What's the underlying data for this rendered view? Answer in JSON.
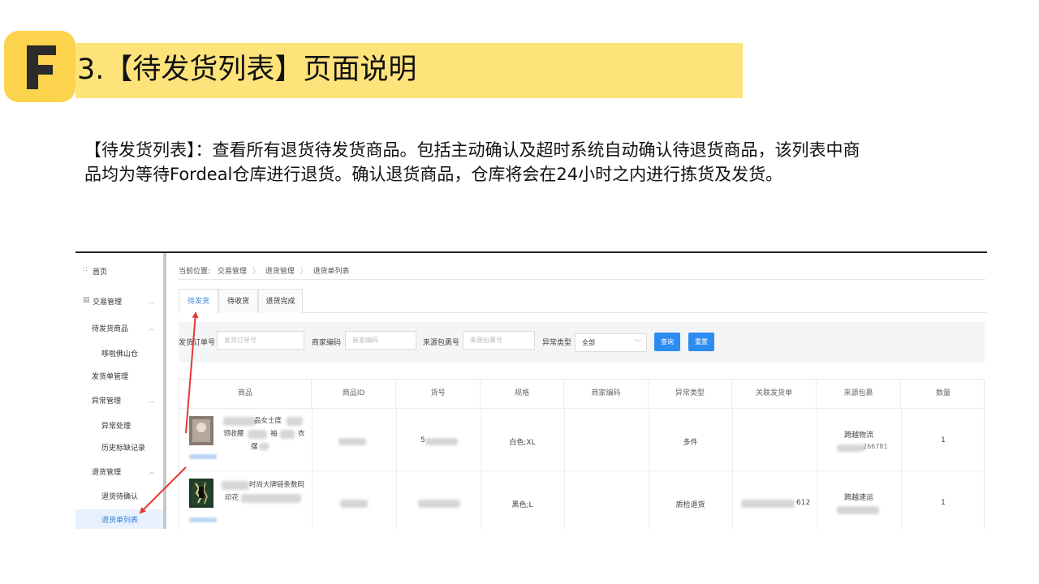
{
  "header": {
    "logo_letter": "F",
    "title": "3.【待发货列表】页面说明",
    "accent_color": "#fde37a",
    "logo_color": "#fcd34d"
  },
  "description": {
    "line1": "【待发货列表】：查看所有退货待发货商品。包括主动确认及超时系统自动确认待退货商品，该列表中商",
    "line2": "品均为等待Fordeal仓库进行退货。确认退货商品，仓库将会在24小时之内进行拣货及发货。"
  },
  "sidebar": {
    "home": "首页",
    "trade_mgmt": "交易管理",
    "pending_goods": "待发货商品",
    "warehouse": "哆啦佛山仓",
    "shipment_mgmt": "发货单管理",
    "exception_mgmt": "异常管理",
    "exception_handle": "异常处理",
    "history_log": "历史标缺记录",
    "return_mgmt": "退货管理",
    "return_confirm": "退货待确认",
    "return_list": "退货单列表",
    "home_icon": "grid-icon",
    "trade_icon": "document-icon"
  },
  "breadcrumb": {
    "prefix": "当前位置:",
    "items": [
      "交易管理",
      "退货管理",
      "退货单列表"
    ]
  },
  "tabs": [
    "待发货",
    "待收货",
    "退货完成"
  ],
  "filters": {
    "order_label": "发货订单号",
    "order_placeholder": "发货订单号",
    "merchant_label": "商家编码",
    "merchant_placeholder": "商家编码",
    "package_label": "来源包裹号",
    "package_placeholder": "来源包裹号",
    "type_label": "异常类型",
    "type_value": "全部",
    "query_button": "查询",
    "reset_button": "重置"
  },
  "table": {
    "headers": [
      "商品",
      "商品ID",
      "货号",
      "规格",
      "商家编码",
      "异常类型",
      "关联发货单",
      "来源包裹",
      "数量"
    ],
    "rows": [
      {
        "product_l1": "品女士度",
        "product_l2_a": "领收腰",
        "product_l2_b": "袖",
        "product_l2_c": "衣",
        "product_l3": "摆",
        "sku_prefix": "5",
        "spec": "白色;XL",
        "type": "多件",
        "linked": "",
        "source": "跨越物流",
        "source_no": "266781",
        "qty": "1"
      },
      {
        "product_l1": "时尚大牌链条数码",
        "product_l2": "印花",
        "sku_prefix": "",
        "spec": "黑色;L",
        "type": "质检退货",
        "linked": "612",
        "source": "跨越速运",
        "source_no": "",
        "qty": "1"
      }
    ]
  },
  "colors": {
    "primary_button": "#2d8cf0",
    "active_tab": "#3b8ad9",
    "annotation_arrow": "#e53935"
  }
}
